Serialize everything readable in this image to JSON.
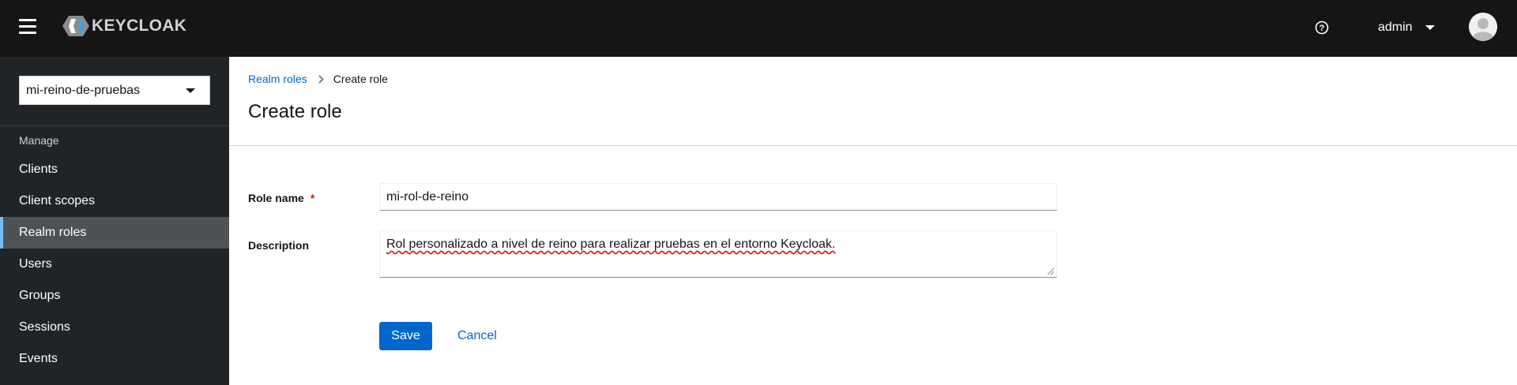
{
  "header": {
    "logo_text": "KEYCLOAK",
    "user_name": "admin",
    "icons": {
      "menu": "hamburger-icon",
      "help": "help-icon",
      "avatar": "user-avatar-icon"
    }
  },
  "sidebar": {
    "realm_selected": "mi-reino-de-pruebas",
    "section_label": "Manage",
    "items": [
      {
        "label": "Clients",
        "active": false
      },
      {
        "label": "Client scopes",
        "active": false
      },
      {
        "label": "Realm roles",
        "active": true
      },
      {
        "label": "Users",
        "active": false
      },
      {
        "label": "Groups",
        "active": false
      },
      {
        "label": "Sessions",
        "active": false
      },
      {
        "label": "Events",
        "active": false
      }
    ]
  },
  "breadcrumb": {
    "parent": "Realm roles",
    "current": "Create role"
  },
  "page": {
    "title": "Create role"
  },
  "form": {
    "role_name_label": "Role name",
    "required_mark": "*",
    "role_name_value": "mi-rol-de-reino",
    "description_label": "Description",
    "description_value": "Rol personalizado a nivel de reino para realizar pruebas en el entorno Keycloak.",
    "save_label": "Save",
    "cancel_label": "Cancel"
  },
  "colors": {
    "masthead": "#151515",
    "sidebar": "#212427",
    "sidebar_active": "#4f5255",
    "active_indicator": "#73bcf7",
    "primary": "#0066cc",
    "required": "#c9190b"
  }
}
